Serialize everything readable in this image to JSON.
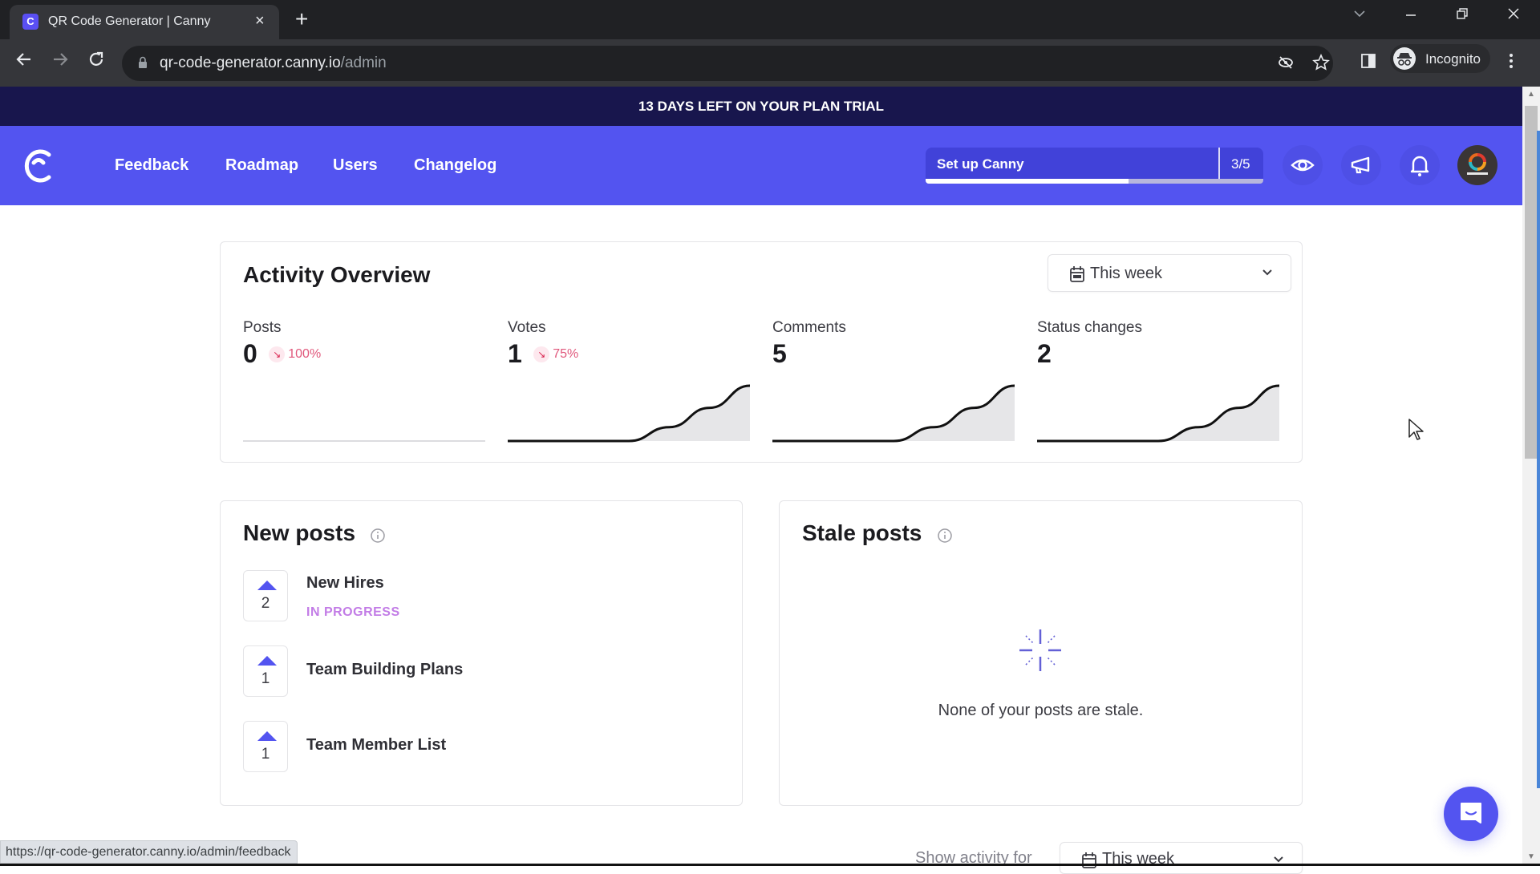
{
  "browser": {
    "tab_title": "QR Code Generator | Canny",
    "favicon_letter": "C",
    "new_tab_label": "+",
    "close_tab_label": "×",
    "url_host": "qr-code-generator.canny.io",
    "url_path": "/admin",
    "profile_label": "Incognito",
    "status_url": "https://qr-code-generator.canny.io/admin/feedback"
  },
  "banner": {
    "text": "13 DAYS LEFT ON YOUR PLAN TRIAL"
  },
  "nav": {
    "links": [
      {
        "label": "Feedback"
      },
      {
        "label": "Roadmap"
      },
      {
        "label": "Users"
      },
      {
        "label": "Changelog"
      }
    ],
    "setup": {
      "label": "Set up Canny",
      "count": "3/5",
      "progress_fraction": 0.6
    },
    "brand_color": "#5354f0",
    "banner_color": "#18164d"
  },
  "activity": {
    "title": "Activity Overview",
    "range": "This week",
    "stats": [
      {
        "label": "Posts",
        "value": "0",
        "change": "100%",
        "direction": "down",
        "series": [
          0,
          0,
          0,
          0,
          0,
          0,
          0
        ]
      },
      {
        "label": "Votes",
        "value": "1",
        "change": "75%",
        "direction": "down",
        "series": [
          0,
          0,
          0,
          0,
          0.25,
          0.6,
          1
        ]
      },
      {
        "label": "Comments",
        "value": "5",
        "change": "",
        "direction": "",
        "series": [
          0,
          0,
          0,
          0,
          0.25,
          0.6,
          1
        ]
      },
      {
        "label": "Status changes",
        "value": "2",
        "change": "",
        "direction": "",
        "series": [
          0,
          0,
          0,
          0,
          0.25,
          0.6,
          1
        ]
      }
    ]
  },
  "new_posts": {
    "title": "New posts",
    "items": [
      {
        "title": "New Hires",
        "votes": "2",
        "status": "IN PROGRESS"
      },
      {
        "title": "Team Building Plans",
        "votes": "1",
        "status": ""
      },
      {
        "title": "Team Member List",
        "votes": "1",
        "status": ""
      }
    ]
  },
  "stale_posts": {
    "title": "Stale posts",
    "empty_text": "None of your posts are stale."
  },
  "footer": {
    "show_activity_label": "Show activity for",
    "range": "This week"
  }
}
